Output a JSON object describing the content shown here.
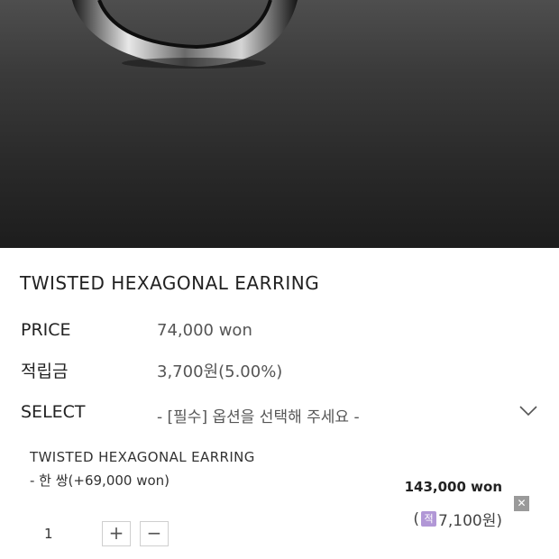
{
  "product": {
    "title": "TWISTED HEXAGONAL EARRING"
  },
  "price": {
    "label": "PRICE",
    "value": "74,000 won"
  },
  "reward": {
    "label": "적립금",
    "value": "3,700원(5.00%)"
  },
  "option_select": {
    "label": "SELECT",
    "placeholder": "- [필수] 옵션을 선택해 주세요 -"
  },
  "selected_option": {
    "name": "TWISTED HEXAGONAL EARRING",
    "variant": "- 한 쌍(+69,000 won)",
    "price": "143,000 won",
    "points_open": "(",
    "points_icon": "적",
    "points_value": "7,100원)",
    "remove_symbol": "✕",
    "quantity": "1",
    "increase_symbol": "+",
    "decrease_symbol": "−"
  },
  "colors": {
    "hero_background": "#2a2a2a",
    "points_badge": "#b197d6",
    "remove_button": "#9a9a9a"
  },
  "icons": [
    "product-image",
    "chevron-down-icon",
    "remove-icon",
    "points-icon",
    "plus-icon",
    "minus-icon"
  ]
}
